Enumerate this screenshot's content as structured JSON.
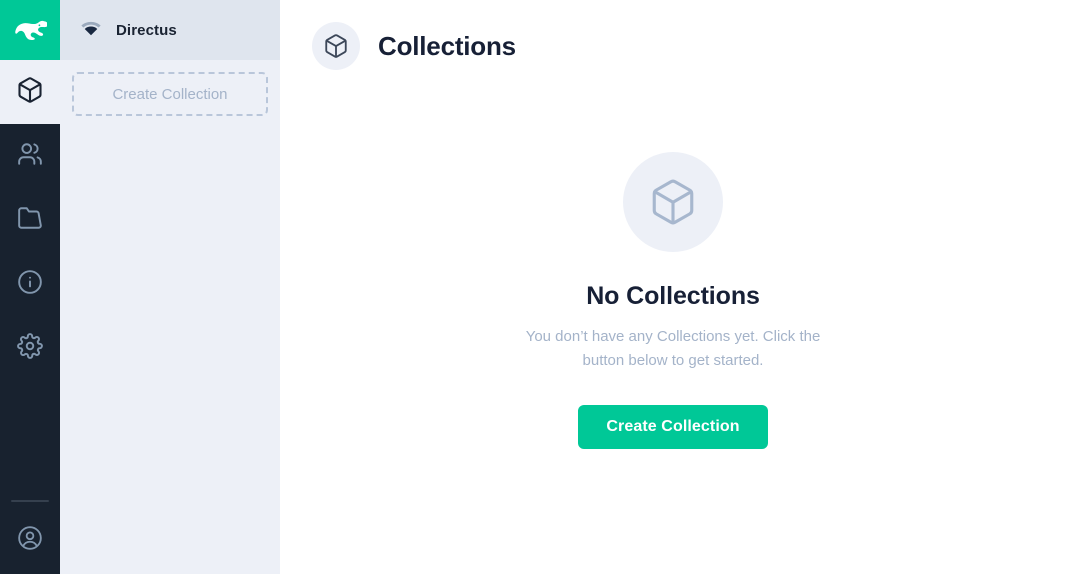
{
  "module_bar": {
    "logo": {
      "icon": "directus-rabbit-logo",
      "background": "#00C897"
    },
    "items": [
      {
        "icon": "box-icon",
        "label": "Collections",
        "active": true
      },
      {
        "icon": "users-icon",
        "label": "User Directory",
        "active": false
      },
      {
        "icon": "folder-icon",
        "label": "File Library",
        "active": false
      },
      {
        "icon": "info-circle-icon",
        "label": "Documentation",
        "active": false
      },
      {
        "icon": "gear-icon",
        "label": "Settings",
        "active": false
      }
    ],
    "account": {
      "icon": "account-circle-icon",
      "label": "Account"
    }
  },
  "sidebar": {
    "project": {
      "icon": "signal-icon",
      "name": "Directus"
    },
    "create_collection_label": "Create Collection"
  },
  "main": {
    "header": {
      "icon": "box-icon",
      "title": "Collections"
    },
    "empty_state": {
      "icon": "box-icon",
      "title": "No Collections",
      "subtitle": "You don’t have any Collections yet. Click the button below to get started.",
      "button_label": "Create Collection"
    }
  },
  "colors": {
    "brand_green": "#00C897",
    "module_bar_bg": "#18222F",
    "sidebar_bg": "#EDF0F7",
    "project_header_bg": "#DFE5EE",
    "text_dark": "#172036",
    "text_muted": "#A4B3C9"
  }
}
